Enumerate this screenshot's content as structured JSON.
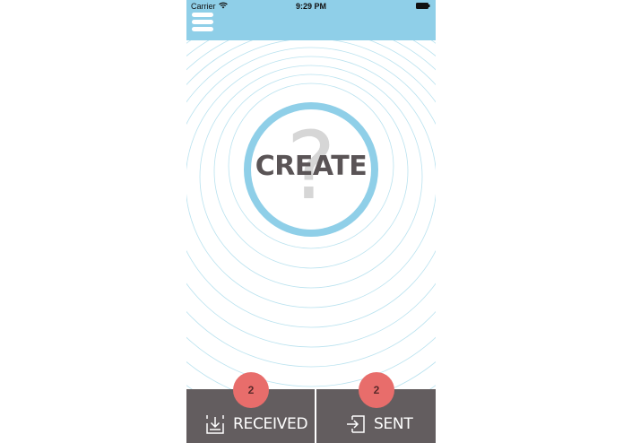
{
  "status_bar": {
    "carrier": "Carrier",
    "time": "9:29 PM"
  },
  "header": {
    "background_color": "#8fcfe8",
    "menu_icon": "hamburger-menu-icon"
  },
  "main": {
    "create_label": "CREATE",
    "create_glyph": "?",
    "ring_color": "#8fcfe8"
  },
  "tabs": {
    "received": {
      "label": "RECEIVED",
      "badge": "2",
      "icon": "inbox-download-icon"
    },
    "sent": {
      "label": "SENT",
      "badge": "2",
      "icon": "send-arrow-icon"
    },
    "background_color": "#635d5f",
    "badge_color": "#e86d6b"
  }
}
